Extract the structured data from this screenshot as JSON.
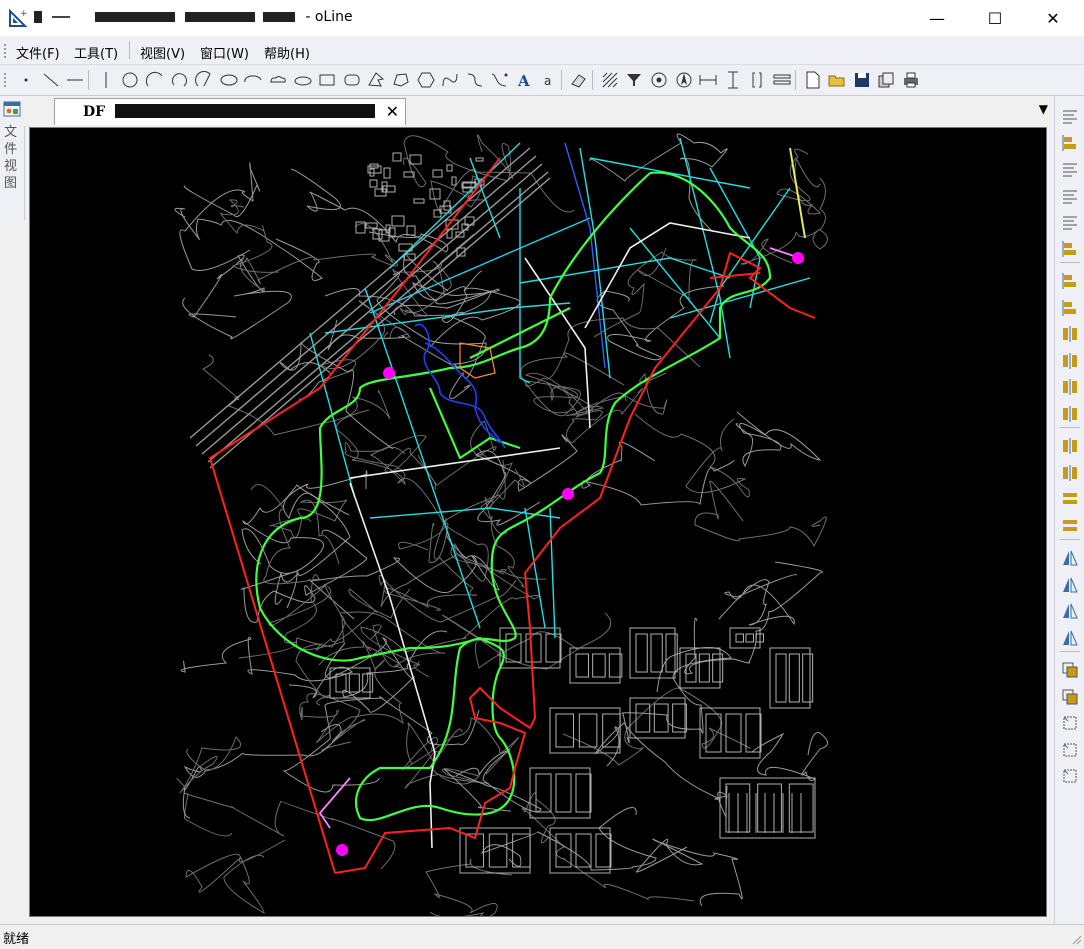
{
  "window": {
    "title_suffix": "- oLine",
    "minimize_glyph": "—",
    "maximize_glyph": "☐",
    "close_glyph": "✕"
  },
  "menu": [
    {
      "label": "文件(F)"
    },
    {
      "label": "工具(T)"
    },
    {
      "label": "视图(V)"
    },
    {
      "label": "窗口(W)"
    },
    {
      "label": "帮助(H)"
    }
  ],
  "toolbar_icons": [
    "point-icon",
    "line-icon",
    "horizontal-line-icon",
    "vertical-line-icon",
    "circle-icon",
    "arc-icon",
    "arc-2-icon",
    "arc-3-icon",
    "ellipse-icon",
    "ellipse-arc-icon",
    "cloud-icon",
    "rounded-rect-icon",
    "rectangle-icon",
    "rounded-rectangle-icon",
    "polygon-arrow-icon",
    "polygon-icon",
    "hexagon-icon",
    "curve-icon",
    "spline-icon",
    "bezier-icon",
    "text-icon",
    "small-text-icon",
    "eraser-icon",
    "hatch-icon",
    "funnel-icon",
    "node-circle-icon",
    "north-arrow-icon",
    "dimension-horizontal-icon",
    "dimension-vertical-icon",
    "bracket-icon",
    "layers-icon",
    "new-file-icon",
    "open-file-icon",
    "save-icon",
    "copy-icon",
    "print-icon"
  ],
  "left_dock": {
    "label": "文件视图"
  },
  "document_tab": {
    "icon_text": "DF",
    "close_glyph": "✕",
    "dropdown_glyph": "▼"
  },
  "right_toolbar_icons": [
    "align-left-icon",
    "align-center-icon",
    "align-right-icon",
    "align-justify-icon",
    "align-bottom-icon",
    "align-top-edge-icon",
    "align-vcenter-icon",
    "align-hcenter-icon",
    "distribute-top-icon",
    "distribute-bottom-icon",
    "distribute-left-icon",
    "distribute-right-icon",
    "distribute-hcenter-icon",
    "distribute-vcenter-icon",
    "same-width-icon",
    "same-height-icon",
    "flip-horizontal-icon",
    "flip-vertical-icon",
    "rotate-left-icon",
    "rotate-right-icon",
    "bring-front-icon",
    "send-back-icon",
    "group-icon",
    "ungroup-icon",
    "transform-icon"
  ],
  "status": {
    "text": "就绪"
  },
  "colors": {
    "canvas": "#000000",
    "road_red": "#ff2020",
    "path_green": "#40ff40",
    "pipe_cyan": "#20e0e0",
    "marker_magenta": "#ff00ff",
    "contour_gray": "#8a8a8a"
  }
}
